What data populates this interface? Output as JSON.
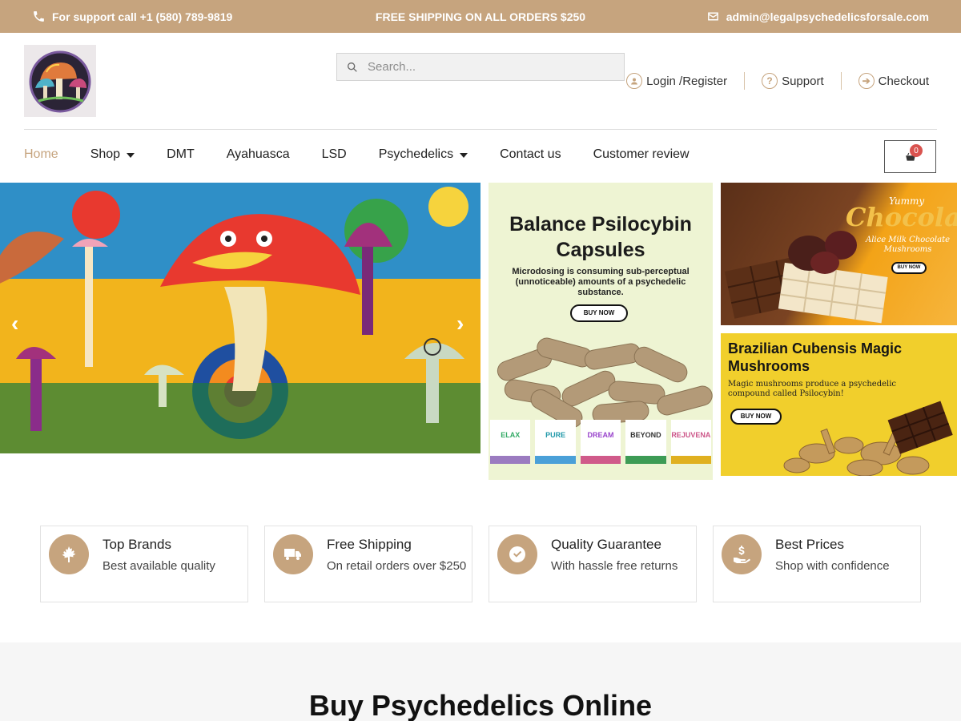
{
  "topbar": {
    "support": "For support call +1 (580) 789-9819",
    "shipping": "FREE SHIPPING ON ALL ORDERS $250",
    "email": "admin@legalpsychedelicsforsale.com"
  },
  "search": {
    "placeholder": "Search..."
  },
  "header_links": [
    {
      "label": "Login /Register",
      "icon": "user-icon"
    },
    {
      "label": "Support",
      "icon": "question-icon"
    },
    {
      "label": "Checkout",
      "icon": "arrow-right-icon"
    }
  ],
  "nav": {
    "items": [
      "Home",
      "Shop",
      "DMT",
      "Ayahuasca",
      "LSD",
      "Psychedelics",
      "Contact us",
      "Customer review"
    ],
    "active": "Home",
    "cart_count": "0"
  },
  "banners": {
    "capsules": {
      "title": "Balance Psilocybin Capsules",
      "subtitle": "Microdosing is consuming sub-perceptual (unnoticeable) amounts of a psychedelic substance.",
      "cta": "BUY NOW",
      "packs": [
        "ELAX",
        "PURE",
        "DREAM",
        "BEYOND",
        "REJUVENA"
      ]
    },
    "chocolate": {
      "kicker": "Yummy",
      "title": "Chocolate",
      "subtitle": "Alice Milk Chocolate Mushrooms",
      "cta": "BUY NOW"
    },
    "cubensis": {
      "title": "Brazilian Cubensis Magic Mushrooms",
      "subtitle": "Magic mushrooms produce a psychedelic compound called Psilocybin!",
      "cta": "BUY NOW"
    }
  },
  "features": [
    {
      "title": "Top Brands",
      "subtitle": "Best available quality",
      "icon": "maple-leaf-icon"
    },
    {
      "title": "Free Shipping",
      "subtitle": "On retail orders over $250",
      "icon": "truck-icon"
    },
    {
      "title": "Quality Guarantee",
      "subtitle": "With hassle free returns",
      "icon": "check-circle-icon"
    },
    {
      "title": "Best Prices",
      "subtitle": "Shop with confidence",
      "icon": "dollar-hand-icon"
    }
  ],
  "section_title": "Buy Psychedelics Online",
  "colors": {
    "accent": "#c6a47e",
    "badge": "#d9534f"
  }
}
